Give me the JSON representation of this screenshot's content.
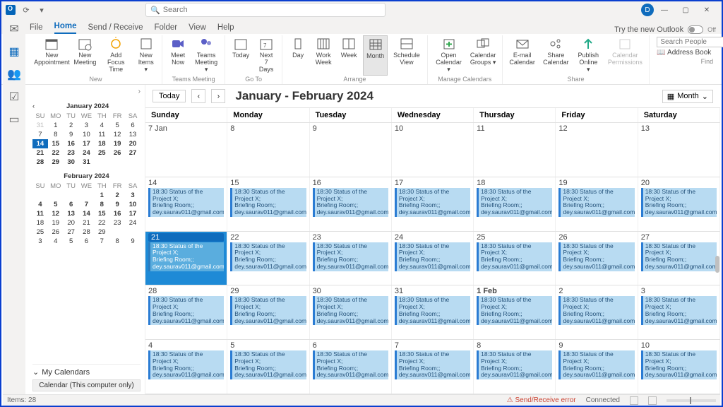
{
  "title_search_placeholder": "Search",
  "avatar_initial": "D",
  "try_label": "Try the new Outlook",
  "toggle_state": "Off",
  "menu_tabs": {
    "file": "File",
    "home": "Home",
    "sendrecv": "Send / Receive",
    "folder": "Folder",
    "view": "View",
    "help": "Help"
  },
  "ribbon": {
    "new_grp": "New",
    "new_appt": "New\nAppointment",
    "new_mtg": "New\nMeeting",
    "focus": "Add Focus\nTime",
    "new_items": "New\nItems ▾",
    "teams_grp": "Teams Meeting",
    "meet_now": "Meet\nNow",
    "teams_mtg": "Teams\nMeeting ▾",
    "goto_grp": "Go To",
    "today": "Today",
    "next7": "Next 7\nDays",
    "arrange_grp": "Arrange",
    "day": "Day",
    "workwk": "Work\nWeek",
    "week": "Week",
    "month": "Month",
    "sched": "Schedule\nView",
    "manage_grp": "Manage Calendars",
    "opencal": "Open\nCalendar ▾",
    "calgrp": "Calendar\nGroups ▾",
    "share_grp": "Share",
    "emailcal": "E-mail\nCalendar",
    "sharecal": "Share\nCalendar",
    "publish": "Publish\nOnline ▾",
    "perm": "Calendar\nPermissions",
    "find_grp": "Find",
    "search_people": "Search People",
    "addrbook": "📖 Address Book"
  },
  "nav": {
    "today_btn": "Today",
    "jan_caption": "January 2024",
    "feb_caption": "February 2024",
    "dow": [
      "SU",
      "MO",
      "TU",
      "WE",
      "TH",
      "FR",
      "SA"
    ],
    "jan_rows": [
      [
        "31",
        "1",
        "2",
        "3",
        "4",
        "5",
        "6"
      ],
      [
        "7",
        "8",
        "9",
        "10",
        "11",
        "12",
        "13"
      ],
      [
        "14",
        "15",
        "16",
        "17",
        "18",
        "19",
        "20"
      ],
      [
        "21",
        "22",
        "23",
        "24",
        "25",
        "26",
        "27"
      ],
      [
        "28",
        "29",
        "30",
        "31",
        "",
        "",
        ""
      ]
    ],
    "feb_rows": [
      [
        "",
        "",
        "",
        "",
        "1",
        "2",
        "3"
      ],
      [
        "4",
        "5",
        "6",
        "7",
        "8",
        "9",
        "10"
      ],
      [
        "11",
        "12",
        "13",
        "14",
        "15",
        "16",
        "17"
      ],
      [
        "18",
        "19",
        "20",
        "21",
        "22",
        "23",
        "24"
      ],
      [
        "25",
        "26",
        "27",
        "28",
        "29",
        "",
        ""
      ],
      [
        "3",
        "4",
        "5",
        "6",
        "7",
        "8",
        "9"
      ]
    ],
    "mycals": "My Calendars",
    "cal_item": "Calendar (This computer only)"
  },
  "calview": {
    "title": "January - February 2024",
    "view_label": "Month",
    "dow": [
      "Sunday",
      "Monday",
      "Tuesday",
      "Wednesday",
      "Thursday",
      "Friday",
      "Saturday"
    ],
    "weeks": [
      [
        {
          "d": "7 Jan"
        },
        {
          "d": "8"
        },
        {
          "d": "9"
        },
        {
          "d": "10"
        },
        {
          "d": "11"
        },
        {
          "d": "12"
        },
        {
          "d": "13"
        }
      ],
      [
        {
          "d": "14",
          "e": true
        },
        {
          "d": "15",
          "e": true
        },
        {
          "d": "16",
          "e": true
        },
        {
          "d": "17",
          "e": true
        },
        {
          "d": "18",
          "e": true
        },
        {
          "d": "19",
          "e": true
        },
        {
          "d": "20",
          "e": true
        }
      ],
      [
        {
          "d": "21",
          "e": true,
          "sel": true
        },
        {
          "d": "22",
          "e": true
        },
        {
          "d": "23",
          "e": true
        },
        {
          "d": "24",
          "e": true
        },
        {
          "d": "25",
          "e": true
        },
        {
          "d": "26",
          "e": true
        },
        {
          "d": "27",
          "e": true
        }
      ],
      [
        {
          "d": "28",
          "e": true
        },
        {
          "d": "29",
          "e": true
        },
        {
          "d": "30",
          "e": true
        },
        {
          "d": "31",
          "e": true
        },
        {
          "d": "1 Feb",
          "e": true,
          "bold": true
        },
        {
          "d": "2",
          "e": true
        },
        {
          "d": "3",
          "e": true
        }
      ],
      [
        {
          "d": "4",
          "e": true
        },
        {
          "d": "5",
          "e": true
        },
        {
          "d": "6",
          "e": true
        },
        {
          "d": "7",
          "e": true
        },
        {
          "d": "8",
          "e": true
        },
        {
          "d": "9",
          "e": true
        },
        {
          "d": "10",
          "e": true
        }
      ]
    ],
    "event_line1": "18:30 Status of the Project X;",
    "event_line2": "Briefing Room;;",
    "event_line3": "dey.saurav011@gmail.com"
  },
  "status": {
    "items": "Items: 28",
    "err": "Send/Receive error",
    "conn": "Connected"
  }
}
